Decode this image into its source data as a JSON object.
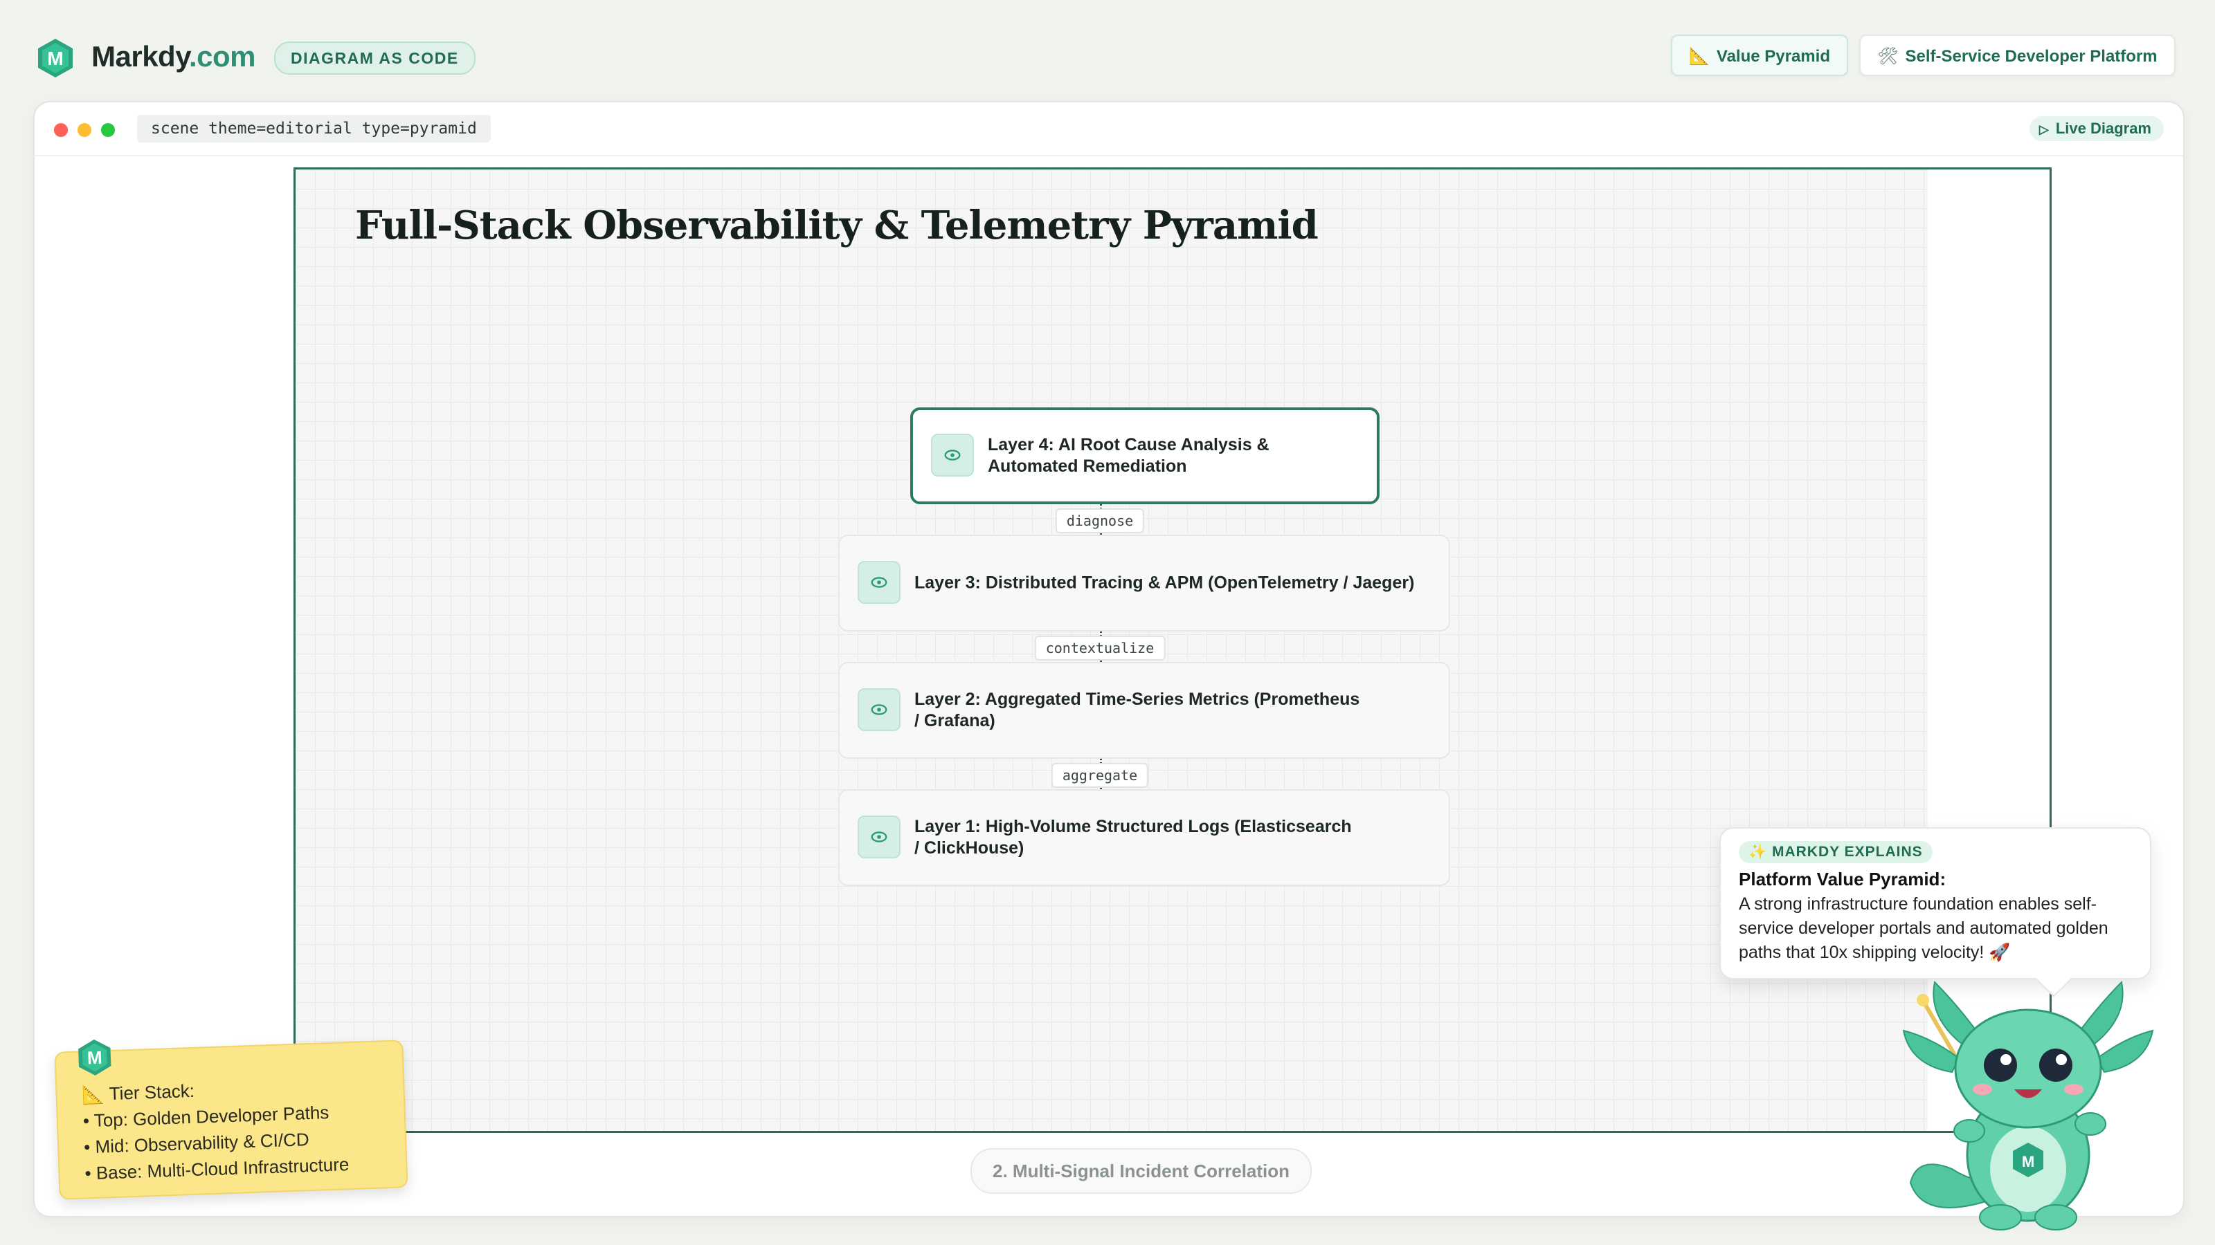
{
  "brand": {
    "name_main": "Markdy",
    "name_tld": ".com",
    "tag": "DIAGRAM AS CODE",
    "logo_letter": "M"
  },
  "top_buttons": [
    {
      "icon": "ruler-triangle-icon",
      "label": "Value Pyramid",
      "active": true
    },
    {
      "icon": "tools-icon",
      "label": "Self-Service Developer Platform",
      "active": false
    }
  ],
  "editor": {
    "scene_code": "scene theme=editorial type=pyramid",
    "live_label": "Live Diagram"
  },
  "diagram": {
    "title": "Full-Stack Observability & Telemetry Pyramid",
    "layers": [
      {
        "label_lines": [
          "Layer 4: AI Root Cause Analysis &",
          "Automated Remediation"
        ],
        "highlighted": true,
        "icon": "eye-icon"
      },
      {
        "label_lines": [
          "Layer 3: Distributed Tracing & APM (OpenTelemetry / Jaeger)"
        ],
        "highlighted": false,
        "icon": "eye-icon"
      },
      {
        "label_lines": [
          "Layer 2: Aggregated Time-Series Metrics (Prometheus",
          "/ Grafana)"
        ],
        "highlighted": false,
        "icon": "eye-icon"
      },
      {
        "label_lines": [
          "Layer 1: High-Volume Structured Logs (Elasticsearch",
          "/ ClickHouse)"
        ],
        "highlighted": false,
        "icon": "eye-icon"
      }
    ],
    "edges": [
      "diagnose",
      "contextualize",
      "aggregate"
    ],
    "caption": "2. Multi-Signal Incident Correlation"
  },
  "sticky_note": {
    "lines": [
      "📐 Tier Stack:",
      "• Top: Golden Developer Paths",
      "• Mid: Observability & CI/CD",
      "• Base: Multi-Cloud Infrastructure"
    ],
    "accent": "#fbe68a"
  },
  "explainer": {
    "tag": "✨ MARKDY EXPLAINS",
    "title": "Platform Value Pyramid:",
    "body": "A strong infrastructure foundation enables self-service developer portals and automated golden paths that 10x shipping velocity! 🚀"
  },
  "colors": {
    "accent": "#2a7a63",
    "canvas_border": "#2a6b5a",
    "brand_dot": "#2e8f74"
  }
}
